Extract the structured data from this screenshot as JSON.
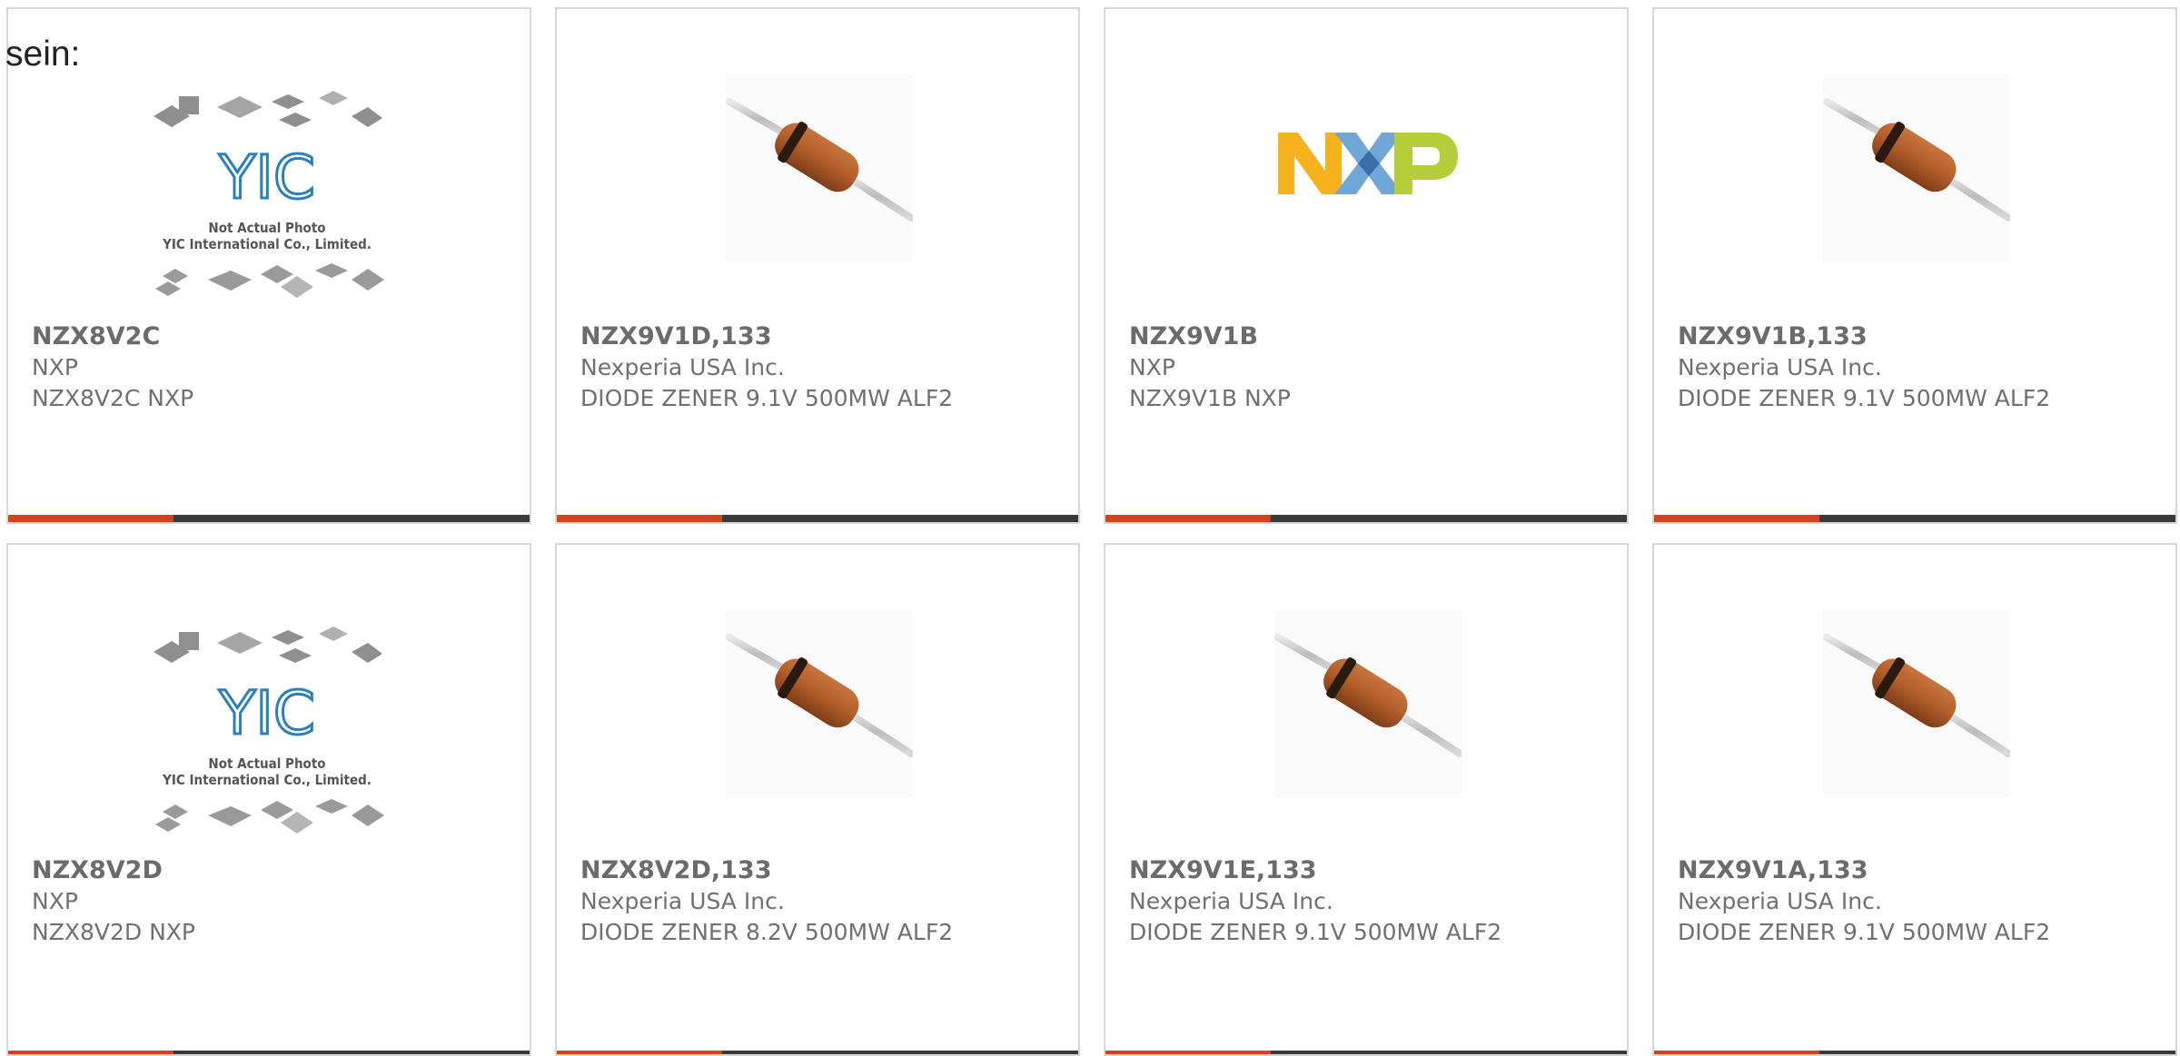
{
  "lead_text": "sein:",
  "colors": {
    "accent": "#d8401a",
    "bar": "#3a3a3a",
    "border": "#d6d6d6",
    "text": "#6b6b6b"
  },
  "placeholder": {
    "logo": "YIC",
    "caption_line1": "Not Actual Photo",
    "caption_line2": "YIC International Co., Limited."
  },
  "nxp_logo": "NXP",
  "products": [
    {
      "part": "NZX8V2C",
      "maker": "NXP",
      "desc": "NZX8V2C NXP",
      "image": "placeholder-icon"
    },
    {
      "part": "NZX9V1D,133",
      "maker": "Nexperia USA Inc.",
      "desc": "DIODE ZENER 9.1V 500MW ALF2",
      "image": "diode-icon"
    },
    {
      "part": "NZX9V1B",
      "maker": "NXP",
      "desc": "NZX9V1B NXP",
      "image": "nxp-logo-icon"
    },
    {
      "part": "NZX9V1B,133",
      "maker": "Nexperia USA Inc.",
      "desc": "DIODE ZENER 9.1V 500MW ALF2",
      "image": "diode-icon"
    },
    {
      "part": "NZX8V2D",
      "maker": "NXP",
      "desc": "NZX8V2D NXP",
      "image": "placeholder-icon"
    },
    {
      "part": "NZX8V2D,133",
      "maker": "Nexperia USA Inc.",
      "desc": "DIODE ZENER 8.2V 500MW ALF2",
      "image": "diode-icon"
    },
    {
      "part": "NZX9V1E,133",
      "maker": "Nexperia USA Inc.",
      "desc": "DIODE ZENER 9.1V 500MW ALF2",
      "image": "diode-icon"
    },
    {
      "part": "NZX9V1A,133",
      "maker": "Nexperia USA Inc.",
      "desc": "DIODE ZENER 9.1V 500MW ALF2",
      "image": "diode-icon"
    }
  ]
}
